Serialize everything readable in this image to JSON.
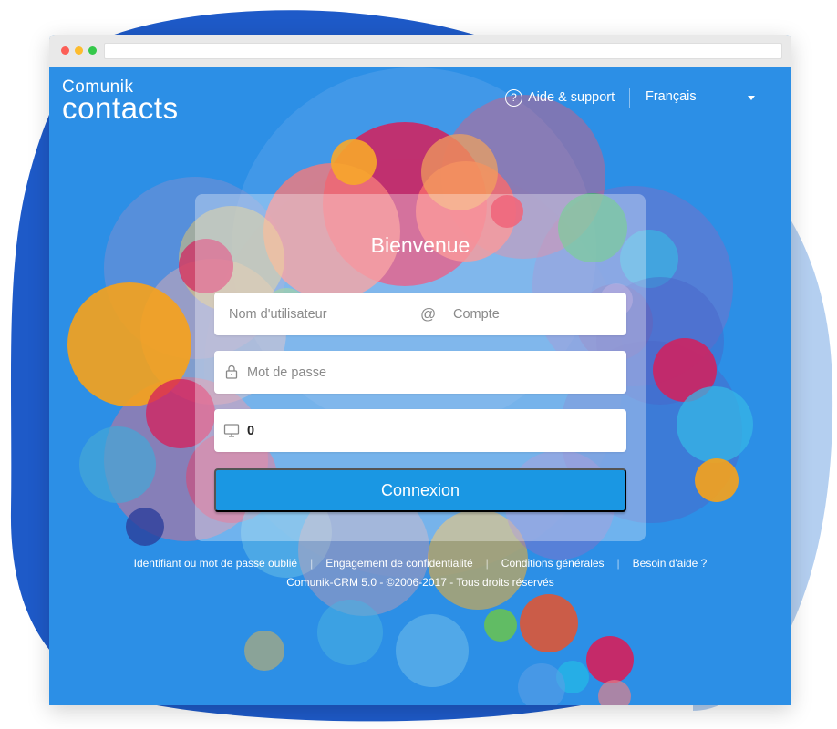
{
  "brand": {
    "line1": "Comunik",
    "line2": "contacts"
  },
  "nav": {
    "help_icon_glyph": "?",
    "help_label": "Aide & support",
    "language_selected": "Français"
  },
  "login": {
    "title": "Bienvenue",
    "username_placeholder": "Nom d'utilisateur",
    "at_symbol": "@",
    "account_placeholder": "Compte",
    "password_placeholder": "Mot de passe",
    "station_value": "0",
    "submit_label": "Connexion"
  },
  "footer": {
    "links": [
      "Identifiant ou mot de passe oublié",
      "Engagement de confidentialité",
      "Conditions générales",
      "Besoin d'aide ?"
    ],
    "copyright": "Comunik-CRM 5.0 - ©2006-2017 - Tous droits réservés"
  },
  "icons": {
    "help": "help-circle-icon",
    "password": "lock-icon",
    "station": "monitor-icon",
    "language": "chevron-down-icon"
  },
  "colors": {
    "page_background": "#2c8fe6",
    "button": "#1a97e3",
    "backdrop_blob_left": "#1e5ac8",
    "backdrop_blob_right": "#b4cff0"
  }
}
